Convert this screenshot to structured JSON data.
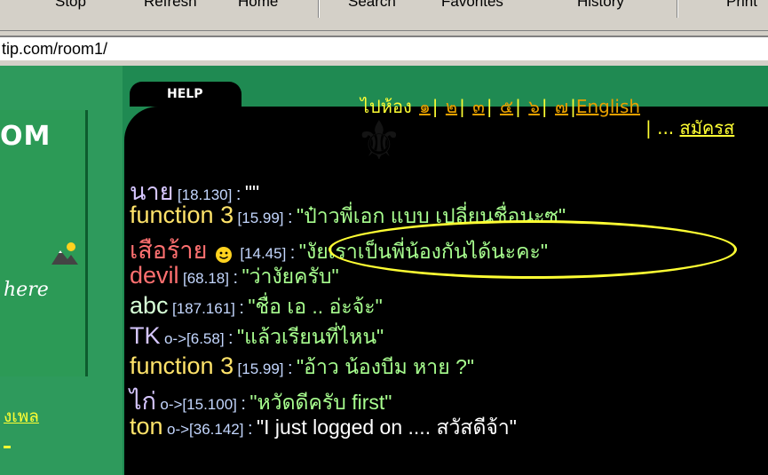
{
  "toolbar": {
    "stop_label": "Stop",
    "refresh_label": "Refresh",
    "home_label": "Home",
    "search_label": "Search",
    "favorites_label": "Favorites",
    "history_label": "History",
    "print_label": "Print"
  },
  "address": {
    "value": "tip.com/room1/"
  },
  "page": {
    "help_label": "HELP",
    "room_title": "OM",
    "here_label": "here",
    "song_link": "งเพล",
    "goto_label": "ไปห้อง",
    "rooms": [
      "๑",
      "๒",
      "๓",
      "๕",
      "๖",
      "๗"
    ],
    "english_link": "English",
    "register_prefix": "| ... ",
    "register_link": "สมัครส"
  },
  "messages": [
    {
      "nick": "นาย",
      "ip": "[18.130]",
      "text": "\"\""
    },
    {
      "nick": "function 3",
      "ip": "[15.99]",
      "text": "\"ป๋าวพี่เอก แบบ เปลี่ยนชื่อนะซ\""
    },
    {
      "nick": "เสือร้าย",
      "ip": "[14.45]",
      "text": "\"งัยเราเป็นพี่น้องกันได้นะคะ\""
    },
    {
      "nick": "devil",
      "ip": "[68.18]",
      "text": "\"ว่างัยครับ\""
    },
    {
      "nick": "abc",
      "ip": "[187.161]",
      "text": "\"ชื่อ เอ .. อ่ะจ้ะ\""
    },
    {
      "nick": "TK",
      "ip": "o->[6.58]",
      "text": "\"แล้วเรียนที่ไหน\""
    },
    {
      "nick": "function 3",
      "ip": "[15.99]",
      "text": "\"อ้าว น้องบีม หาย ?\""
    },
    {
      "nick": "ไก่",
      "ip": "o->[15.100]",
      "text": "\"หวัดดีครับ first\""
    },
    {
      "nick": "ton",
      "ip": "o->[36.142]",
      "text": "\"I just logged on .... สวัสดีจ้า\""
    }
  ],
  "colors": {
    "chat_bg": "#000000",
    "page_green": "#1f8a52",
    "link_yellow": "#ffff33",
    "message_green": "#a8ff8f",
    "annotation": "#ffff33"
  }
}
